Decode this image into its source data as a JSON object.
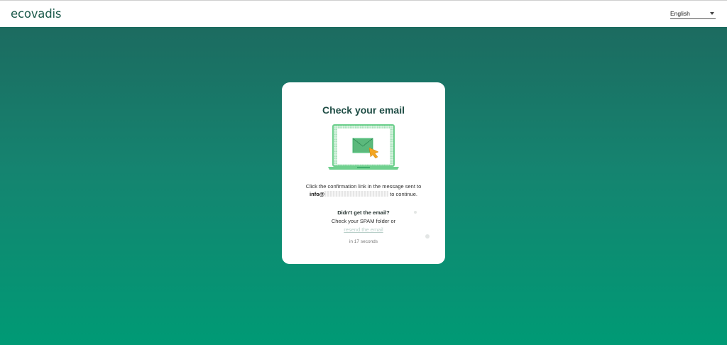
{
  "brand": {
    "logo_text": "ecovadis"
  },
  "header": {
    "language": "English"
  },
  "card": {
    "title": "Check your email",
    "message_before": "Click the confirmation link in the message sent to",
    "email_visible": "info@",
    "message_after": "to continue.",
    "didnt_get": "Didn't get the email?",
    "check_spam": "Check your SPAM folder or",
    "resend_link": "resend the email",
    "countdown": "in 17 seconds"
  },
  "colors": {
    "brand_dark": "#1c5a4b",
    "bg_top": "#1c6b60",
    "bg_bottom": "#009a75",
    "illus_green": "#6fd08e",
    "cursor": "#f3a521"
  }
}
